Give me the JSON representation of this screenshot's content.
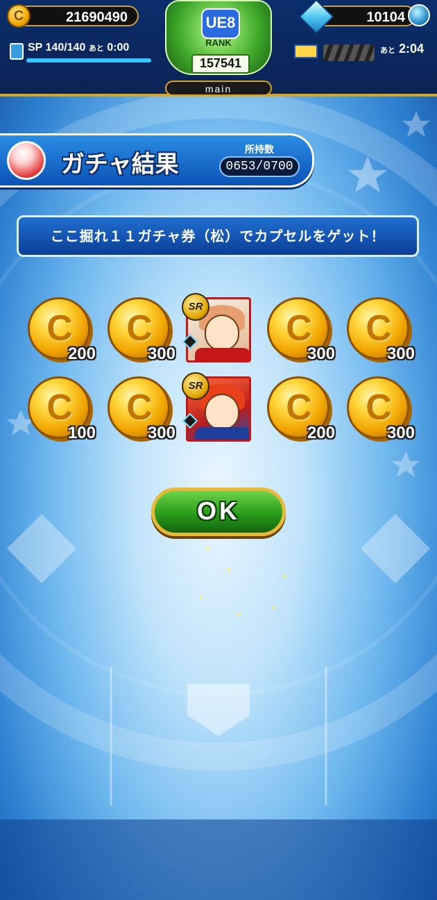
{
  "header": {
    "coins": "21690490",
    "coin_symbol": "C",
    "gems": "10104",
    "sp_label": "SP",
    "sp_value": "140/140",
    "sp_remaining_label": "あと",
    "sp_remaining_time": "0:00",
    "sp_fill": 1.0,
    "rank_badge": "UE8",
    "rank_label": "RANK",
    "rank_value": "157541",
    "profile_tag": "main",
    "stamina_remaining_label": "あと",
    "stamina_remaining_time": "2:04"
  },
  "title": {
    "text": "ガチャ結果",
    "owned_label": "所持数",
    "owned_value": "0653/0700"
  },
  "message": "ここ掘れ１１ガチャ券（松）でカプセルをゲット！",
  "results": [
    {
      "kind": "coin",
      "symbol": "C",
      "amount": "200"
    },
    {
      "kind": "coin",
      "symbol": "C",
      "amount": "300"
    },
    {
      "kind": "card",
      "rarity": "SR",
      "style": "pink"
    },
    {
      "kind": "coin",
      "symbol": "C",
      "amount": "300"
    },
    {
      "kind": "coin",
      "symbol": "C",
      "amount": "300"
    },
    {
      "kind": "coin",
      "symbol": "C",
      "amount": "100"
    },
    {
      "kind": "coin",
      "symbol": "C",
      "amount": "300"
    },
    {
      "kind": "card",
      "rarity": "SR",
      "style": "red"
    },
    {
      "kind": "coin",
      "symbol": "C",
      "amount": "200"
    },
    {
      "kind": "coin",
      "symbol": "C",
      "amount": "300"
    }
  ],
  "ok_label": "OK"
}
